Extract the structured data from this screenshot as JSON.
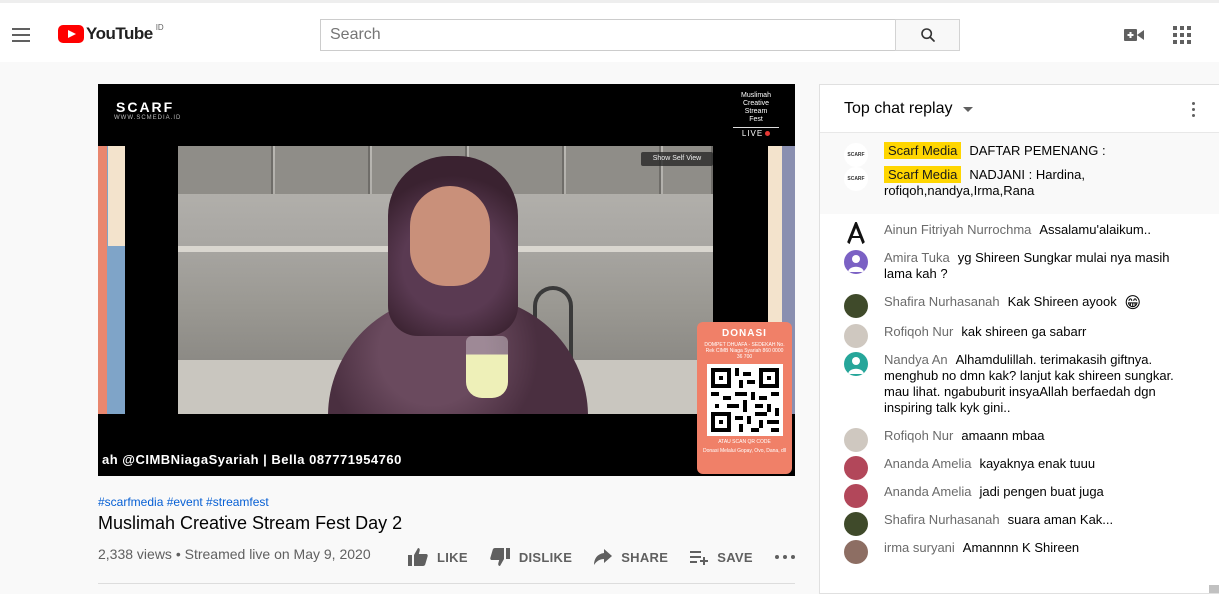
{
  "header": {
    "brand": "YouTube",
    "country_code": "ID",
    "search_placeholder": "Search"
  },
  "video": {
    "overlay_logo": "SCARF",
    "overlay_logo_sub": "WWW.SCMEDIA.ID",
    "overlay_fest": [
      "Muslimah",
      "Creative",
      "Stream",
      "Fest"
    ],
    "overlay_live": "LIVE",
    "self_view": "Show Self View",
    "ticker": "ah @CIMBNiagaSyariah | Bella 087771954760",
    "donasi": {
      "title": "DONASI",
      "text": "DOMPET DHUAFA - SEDEKAH No. Rek CIMB Niaga Syariah 860 0000 36 700",
      "scan": "ATAU SCAN QR CODE",
      "footer": "Donasi Melalui Gopay, Ovo, Dana, dll"
    }
  },
  "info": {
    "tags": "#scarfmedia #event #streamfest",
    "title": "Muslimah Creative Stream Fest Day 2",
    "views": "2,338 views • Streamed live on May 9, 2020",
    "like": "LIKE",
    "dislike": "DISLIKE",
    "share": "SHARE",
    "save": "SAVE"
  },
  "chat": {
    "header": "Top chat replay",
    "pinned": [
      {
        "author": "Scarf Media",
        "text": "DAFTAR PEMENANG :"
      },
      {
        "author": "Scarf Media",
        "text": "NADJANI : Hardina, rofiqoh,nandya,Irma,Rana"
      }
    ],
    "messages": [
      {
        "author": "Ainun Fitriyah Nurrochma",
        "text": "Assalamu'alaikum..",
        "avatar": "letter-a"
      },
      {
        "author": "Amira Tuka",
        "text": "yg Shireen Sungkar mulai nya masih lama kah ?",
        "avatar": "#7b61c4"
      },
      {
        "author": "Shafira Nurhasanah",
        "text": "Kak Shireen ayook",
        "avatar": "#3f4a2a",
        "emoji": "😁"
      },
      {
        "author": "Rofiqoh Nur",
        "text": "kak shireen ga sabarr",
        "avatar": "#cfc8c0"
      },
      {
        "author": "Nandya An",
        "text": "Alhamdulillah. terimakasih giftnya. menghub no dmn kak? lanjut kak shireen sungkar. mau lihat. ngabuburit insyaAllah berfaedah dgn inspiring talk kyk gini..",
        "avatar": "#26a69a"
      },
      {
        "author": "Rofiqoh Nur",
        "text": "amaann mbaa",
        "avatar": "#cfc8c0"
      },
      {
        "author": "Ananda Amelia",
        "text": "kayaknya enak tuuu",
        "avatar": "#b2475a"
      },
      {
        "author": "Ananda Amelia",
        "text": "jadi pengen buat juga",
        "avatar": "#b2475a"
      },
      {
        "author": "Shafira Nurhasanah",
        "text": "suara aman Kak...",
        "avatar": "#3f4a2a"
      },
      {
        "author": "irma suryani",
        "text": "Amannnn K Shireen",
        "avatar": "#8d6e63"
      }
    ]
  }
}
